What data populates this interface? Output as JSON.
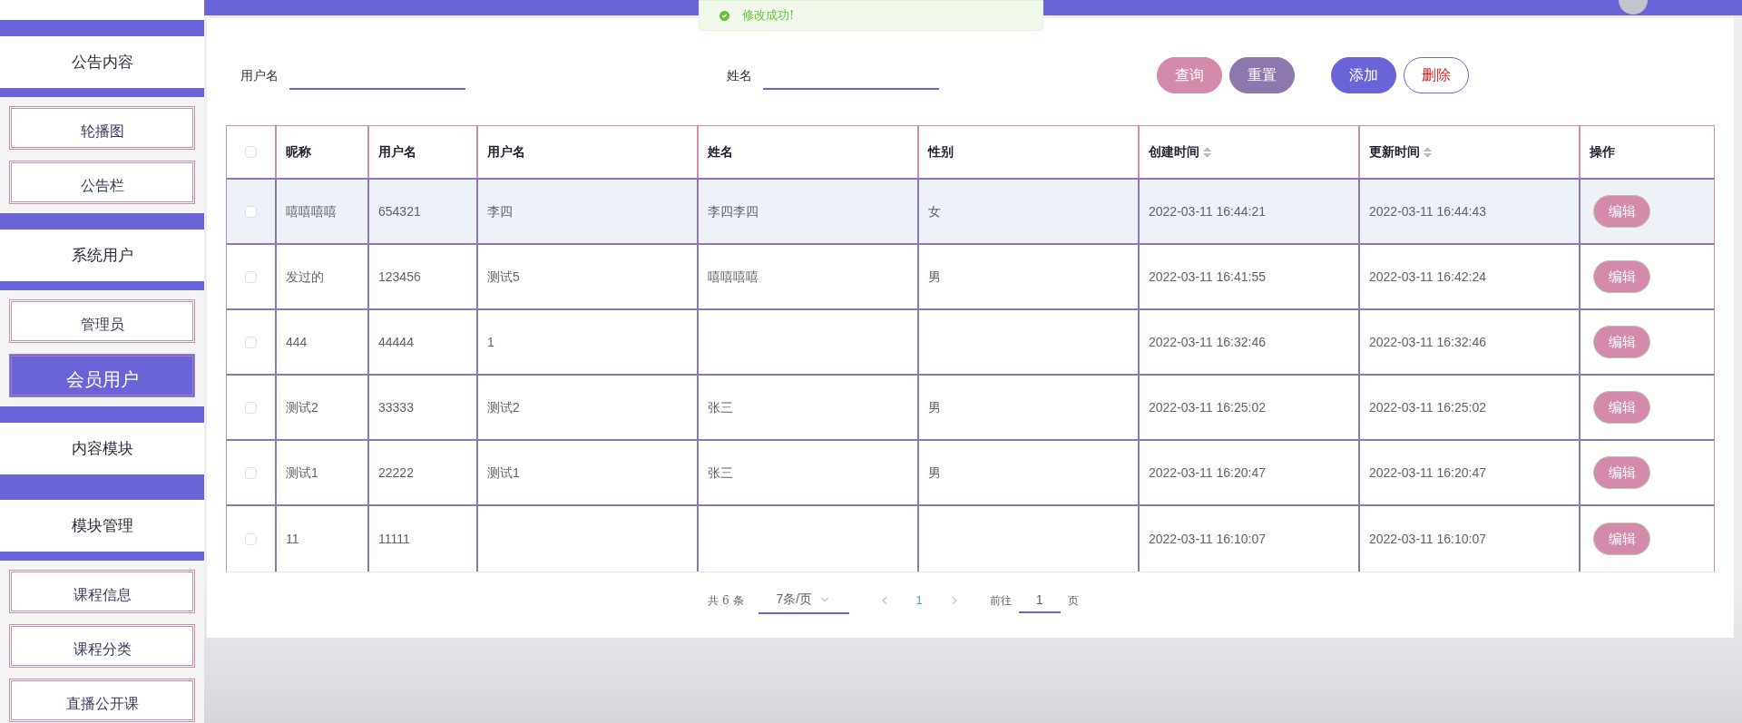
{
  "toast": {
    "text": "修改成功!"
  },
  "sidebar": [
    {
      "label": "公告内容",
      "children": [
        {
          "label": "轮播图",
          "selected": false
        },
        {
          "label": "公告栏",
          "selected": false
        }
      ]
    },
    {
      "label": "系统用户",
      "children": [
        {
          "label": "管理员",
          "selected": false
        },
        {
          "label": "会员用户",
          "selected": true
        }
      ]
    },
    {
      "label": "内容模块"
    },
    {
      "label": "模块管理",
      "children": [
        {
          "label": "课程信息",
          "selected": false
        },
        {
          "label": "课程分类",
          "selected": false
        },
        {
          "label": "直播公开课",
          "selected": false
        }
      ]
    }
  ],
  "search": [
    {
      "label": "用户名"
    },
    {
      "label": "姓名"
    }
  ],
  "buttons": [
    {
      "label": "查询",
      "kind": "query"
    },
    {
      "label": "重置",
      "kind": "reset"
    },
    {
      "label": "添加",
      "kind": "add"
    },
    {
      "label": "删除",
      "kind": "delete"
    }
  ],
  "table": {
    "select_all": {
      "checked": false
    },
    "columns": [
      {
        "label": "昵称",
        "sortable": false
      },
      {
        "label": "用户名",
        "sortable": false
      },
      {
        "label": "用户名",
        "sortable": false
      },
      {
        "label": "姓名",
        "sortable": false
      },
      {
        "label": "性别",
        "sortable": false
      },
      {
        "label": "创建时间",
        "sortable": true
      },
      {
        "label": "更新时间",
        "sortable": true
      },
      {
        "label": "操作",
        "sortable": false
      }
    ],
    "rows": [
      {
        "checked": false,
        "hovered": true,
        "cells": [
          "嘻嘻嘻嘻",
          "654321",
          "李四",
          "李四李四",
          "女",
          "2022-03-11 16:44:21",
          "2022-03-11 16:44:43"
        ],
        "action": "编辑"
      },
      {
        "checked": false,
        "hovered": false,
        "cells": [
          "发过的",
          "123456",
          "测试5",
          "嘻嘻嘻嘻",
          "男",
          "2022-03-11 16:41:55",
          "2022-03-11 16:42:24"
        ],
        "action": "编辑"
      },
      {
        "checked": false,
        "hovered": false,
        "cells": [
          "444",
          "44444",
          "1",
          "",
          "",
          "2022-03-11 16:32:46",
          "2022-03-11 16:32:46"
        ],
        "action": "编辑"
      },
      {
        "checked": false,
        "hovered": false,
        "cells": [
          "测试2",
          "33333",
          "测试2",
          "张三",
          "男",
          "2022-03-11 16:25:02",
          "2022-03-11 16:25:02"
        ],
        "action": "编辑"
      },
      {
        "checked": false,
        "hovered": false,
        "cells": [
          "测试1",
          "22222",
          "测试1",
          "张三",
          "男",
          "2022-03-11 16:20:47",
          "2022-03-11 16:20:47"
        ],
        "action": "编辑"
      },
      {
        "checked": false,
        "hovered": false,
        "cells": [
          "11",
          "11111",
          "",
          "",
          "",
          "2022-03-11 16:10:07",
          "2022-03-11 16:10:07"
        ],
        "action": "编辑"
      }
    ]
  },
  "pagination": {
    "total": "共 6 条",
    "page_size": "7条/页",
    "pages": [
      {
        "label": "1",
        "selected": true
      }
    ],
    "goto_label": "前往",
    "goto_value": "1",
    "goto_unit": "页"
  }
}
